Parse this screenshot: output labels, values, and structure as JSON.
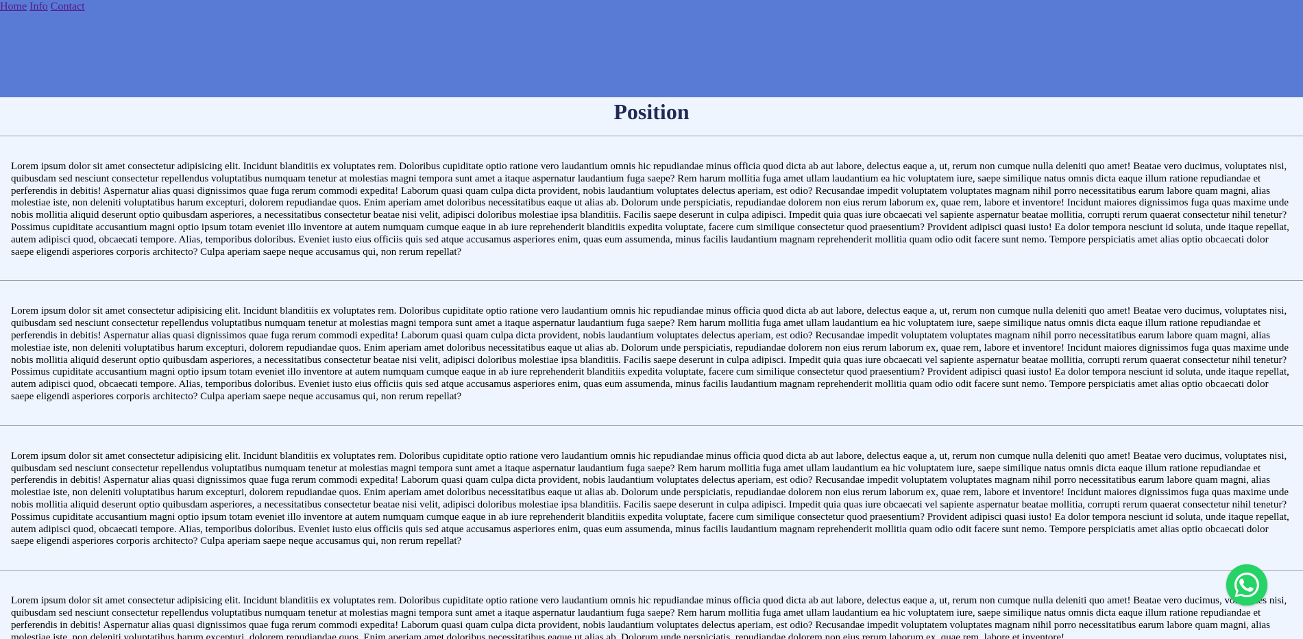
{
  "nav": {
    "home": "Home",
    "info": "Info",
    "contact": "Contact"
  },
  "page": {
    "title": "Position"
  },
  "sections": [
    "Lorem ipsum dolor sit amet consectetur adipisicing elit. Incidunt blanditiis ex voluptates rem. Doloribus cupiditate optio ratione vero laudantium omnis hic repudiandae minus officia quod dicta ab aut labore, delectus eaque a, ut, rerum non cumque nulla deleniti quo amet! Beatae vero ducimus, voluptates nisi, quibusdam sed nesciunt consectetur repellendus voluptatibus numquam tenetur at molestias magni tempora sunt amet a itaque aspernatur laudantium fuga saepe? Rem harum mollitia fuga amet ullam laudantium ea hic voluptatem iure, saepe similique natus omnis dicta eaque illum ratione repudiandae et perferendis in debitis! Aspernatur alias quasi dignissimos quae fuga rerum commodi expedita! Laborum quasi quam culpa dicta provident, nobis laudantium voluptates delectus aperiam, est odio? Recusandae impedit voluptatem voluptates magnam nihil porro necessitatibus earum labore quam magni, alias molestiae iste, non deleniti voluptatibus harum excepturi, dolorem repudiandae quos. Enim aperiam amet doloribus necessitatibus eaque ut alias ab. Dolorum unde perspiciatis, repudiandae dolorem non eius rerum laborum ex, quae rem, labore et inventore! Incidunt maiores dignissimos fuga quas maxime unde nobis mollitia aliquid deserunt optio quibusdam asperiores, a necessitatibus consectetur beatae nisi velit, adipisci doloribus molestiae ipsa blanditiis. Facilis saepe deserunt in culpa adipisci. Impedit quia quas iure obcaecati vel sapiente aspernatur beatae mollitia, corrupti rerum quaerat consectetur nihil tenetur? Possimus cupiditate accusantium magni optio ipsum totam eveniet illo inventore at autem numquam cumque eaque in ab iure reprehenderit blanditiis expedita voluptate, facere cum similique consectetur quod praesentium? Provident adipisci quasi iusto! Ea dolor tempora nesciunt id soluta, unde itaque repellat, autem adipisci quod, obcaecati tempore. Alias, temporibus doloribus. Eveniet iusto eius officiis quis sed atque accusamus asperiores enim, quas eum assumenda, minus facilis laudantium magnam reprehenderit mollitia quam odio odit facere sunt nemo. Tempore perspiciatis amet alias optio obcaecati dolor saepe eligendi asperiores corporis architecto? Culpa aperiam saepe neque accusamus qui, non rerum repellat?",
    "Lorem ipsum dolor sit amet consectetur adipisicing elit. Incidunt blanditiis ex voluptates rem. Doloribus cupiditate optio ratione vero laudantium omnis hic repudiandae minus officia quod dicta ab aut labore, delectus eaque a, ut, rerum non cumque nulla deleniti quo amet! Beatae vero ducimus, voluptates nisi, quibusdam sed nesciunt consectetur repellendus voluptatibus numquam tenetur at molestias magni tempora sunt amet a itaque aspernatur laudantium fuga saepe? Rem harum mollitia fuga amet ullam laudantium ea hic voluptatem iure, saepe similique natus omnis dicta eaque illum ratione repudiandae et perferendis in debitis! Aspernatur alias quasi dignissimos quae fuga rerum commodi expedita! Laborum quasi quam culpa dicta provident, nobis laudantium voluptates delectus aperiam, est odio? Recusandae impedit voluptatem voluptates magnam nihil porro necessitatibus earum labore quam magni, alias molestiae iste, non deleniti voluptatibus harum excepturi, dolorem repudiandae quos. Enim aperiam amet doloribus necessitatibus eaque ut alias ab. Dolorum unde perspiciatis, repudiandae dolorem non eius rerum laborum ex, quae rem, labore et inventore! Incidunt maiores dignissimos fuga quas maxime unde nobis mollitia aliquid deserunt optio quibusdam asperiores, a necessitatibus consectetur beatae nisi velit, adipisci doloribus molestiae ipsa blanditiis. Facilis saepe deserunt in culpa adipisci. Impedit quia quas iure obcaecati vel sapiente aspernatur beatae mollitia, corrupti rerum quaerat consectetur nihil tenetur? Possimus cupiditate accusantium magni optio ipsum totam eveniet illo inventore at autem numquam cumque eaque in ab iure reprehenderit blanditiis expedita voluptate, facere cum similique consectetur quod praesentium? Provident adipisci quasi iusto! Ea dolor tempora nesciunt id soluta, unde itaque repellat, autem adipisci quod, obcaecati tempore. Alias, temporibus doloribus. Eveniet iusto eius officiis quis sed atque accusamus asperiores enim, quas eum assumenda, minus facilis laudantium magnam reprehenderit mollitia quam odio odit facere sunt nemo. Tempore perspiciatis amet alias optio obcaecati dolor saepe eligendi asperiores corporis architecto? Culpa aperiam saepe neque accusamus qui, non rerum repellat?",
    "Lorem ipsum dolor sit amet consectetur adipisicing elit. Incidunt blanditiis ex voluptates rem. Doloribus cupiditate optio ratione vero laudantium omnis hic repudiandae minus officia quod dicta ab aut labore, delectus eaque a, ut, rerum non cumque nulla deleniti quo amet! Beatae vero ducimus, voluptates nisi, quibusdam sed nesciunt consectetur repellendus voluptatibus numquam tenetur at molestias magni tempora sunt amet a itaque aspernatur laudantium fuga saepe? Rem harum mollitia fuga amet ullam laudantium ea hic voluptatem iure, saepe similique natus omnis dicta eaque illum ratione repudiandae et perferendis in debitis! Aspernatur alias quasi dignissimos quae fuga rerum commodi expedita! Laborum quasi quam culpa dicta provident, nobis laudantium voluptates delectus aperiam, est odio? Recusandae impedit voluptatem voluptates magnam nihil porro necessitatibus earum labore quam magni, alias molestiae iste, non deleniti voluptatibus harum excepturi, dolorem repudiandae quos. Enim aperiam amet doloribus necessitatibus eaque ut alias ab. Dolorum unde perspiciatis, repudiandae dolorem non eius rerum laborum ex, quae rem, labore et inventore! Incidunt maiores dignissimos fuga quas maxime unde nobis mollitia aliquid deserunt optio quibusdam asperiores, a necessitatibus consectetur beatae nisi velit, adipisci doloribus molestiae ipsa blanditiis. Facilis saepe deserunt in culpa adipisci. Impedit quia quas iure obcaecati vel sapiente aspernatur beatae mollitia, corrupti rerum quaerat consectetur nihil tenetur? Possimus cupiditate accusantium magni optio ipsum totam eveniet illo inventore at autem numquam cumque eaque in ab iure reprehenderit blanditiis expedita voluptate, facere cum similique consectetur quod praesentium? Provident adipisci quasi iusto! Ea dolor tempora nesciunt id soluta, unde itaque repellat, autem adipisci quod, obcaecati tempore. Alias, temporibus doloribus. Eveniet iusto eius officiis quis sed atque accusamus asperiores enim, quas eum assumenda, minus facilis laudantium magnam reprehenderit mollitia quam odio odit facere sunt nemo. Tempore perspiciatis amet alias optio obcaecati dolor saepe eligendi asperiores corporis architecto? Culpa aperiam saepe neque accusamus qui, non rerum repellat?",
    "Lorem ipsum dolor sit amet consectetur adipisicing elit. Incidunt blanditiis ex voluptates rem. Doloribus cupiditate optio ratione vero laudantium omnis hic repudiandae minus officia quod dicta ab aut labore, delectus eaque a, ut, rerum non cumque nulla deleniti quo amet! Beatae vero ducimus, voluptates nisi, quibusdam sed nesciunt consectetur repellendus voluptatibus numquam tenetur at molestias magni tempora sunt amet a itaque aspernatur laudantium fuga saepe? Rem harum mollitia fuga amet ullam laudantium ea hic voluptatem iure, saepe similique natus omnis dicta eaque illum ratione repudiandae et perferendis in debitis! Aspernatur alias quasi dignissimos quae fuga rerum commodi expedita! Laborum quasi quam culpa dicta provident, nobis laudantium voluptates delectus aperiam, est odio? Recusandae impedit voluptatem voluptates magnam nihil porro necessitatibus earum labore quam magni, alias molestiae iste, non deleniti voluptatibus harum excepturi, dolorem repudiandae quos. Enim aperiam amet doloribus necessitatibus eaque ut alias ab. Dolorum unde perspiciatis, repudiandae dolorem non eius rerum laborum ex, quae rem, labore et inventore!"
  ],
  "widgets": {
    "whatsapp_icon": "whatsapp-icon",
    "whatsapp_color": "#25d366"
  },
  "colors": {
    "header_bg": "#5a7bd5",
    "page_bg": "#eef5ff",
    "title": "#1f2a56",
    "link": "#551a8b"
  }
}
